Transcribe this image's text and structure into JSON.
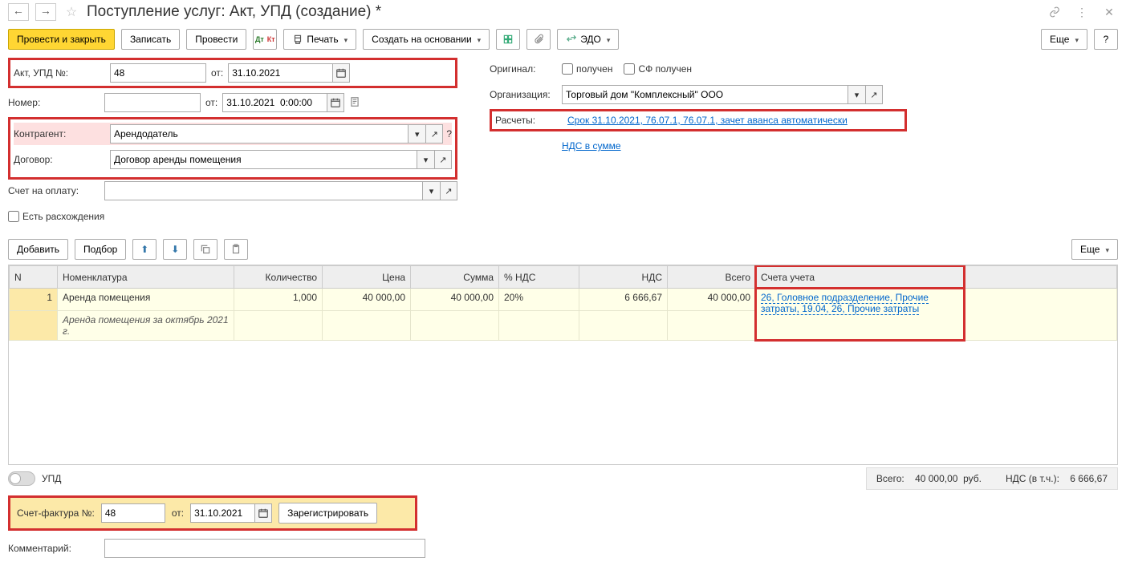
{
  "title": "Поступление услуг: Акт, УПД (создание) *",
  "toolbar": {
    "post_close": "Провести и закрыть",
    "save": "Записать",
    "post": "Провести",
    "print": "Печать",
    "create_based": "Создать на основании",
    "edo": "ЭДО",
    "more": "Еще",
    "help": "?"
  },
  "form": {
    "akt_lbl": "Акт, УПД №:",
    "akt_no": "48",
    "ot": "от:",
    "akt_date": "31.10.2021",
    "nomer_lbl": "Номер:",
    "nomer": "",
    "nomer_date": "31.10.2021  0:00:00",
    "contr_lbl": "Контрагент:",
    "contr": "Арендодатель",
    "dogovor_lbl": "Договор:",
    "dogovor": "Договор аренды помещения",
    "schet_lbl": "Счет на оплату:",
    "schet": "",
    "rash_lbl": "Есть расхождения",
    "original_lbl": "Оригинал:",
    "poluchen": "получен",
    "sf_poluchen": "СФ получен",
    "org_lbl": "Организация:",
    "org": "Торговый дом \"Комплексный\" ООО",
    "raschety_lbl": "Расчеты:",
    "raschety": "Срок 31.10.2021, 76.07.1, 76.07.1, зачет аванса автоматически",
    "nds_link": "НДС в сумме"
  },
  "tbl_toolbar": {
    "add": "Добавить",
    "pick": "Подбор",
    "more": "Еще"
  },
  "table": {
    "headers": {
      "n": "N",
      "nom": "Номенклатура",
      "qty": "Количество",
      "price": "Цена",
      "sum": "Сумма",
      "nds_pct": "% НДС",
      "nds": "НДС",
      "total": "Всего",
      "accounts": "Счета учета"
    },
    "rows": [
      {
        "n": "1",
        "nom": "Аренда помещения",
        "desc": "Аренда помещения за октябрь 2021 г.",
        "qty": "1,000",
        "price": "40 000,00",
        "sum": "40 000,00",
        "nds_pct": "20%",
        "nds": "6 666,67",
        "total": "40 000,00",
        "accounts": "26, Головное подразделение, Прочие затраты, 19.04, 26, Прочие затраты"
      }
    ]
  },
  "upd_lbl": "УПД",
  "totals": {
    "total_lbl": "Всего:",
    "total": "40 000,00",
    "rub": "руб.",
    "nds_lbl": "НДС (в т.ч.):",
    "nds": "6 666,67"
  },
  "sf": {
    "lbl": "Счет-фактура №:",
    "no": "48",
    "ot": "от:",
    "date": "31.10.2021",
    "reg": "Зарегистрировать"
  },
  "comment_lbl": "Комментарий:"
}
